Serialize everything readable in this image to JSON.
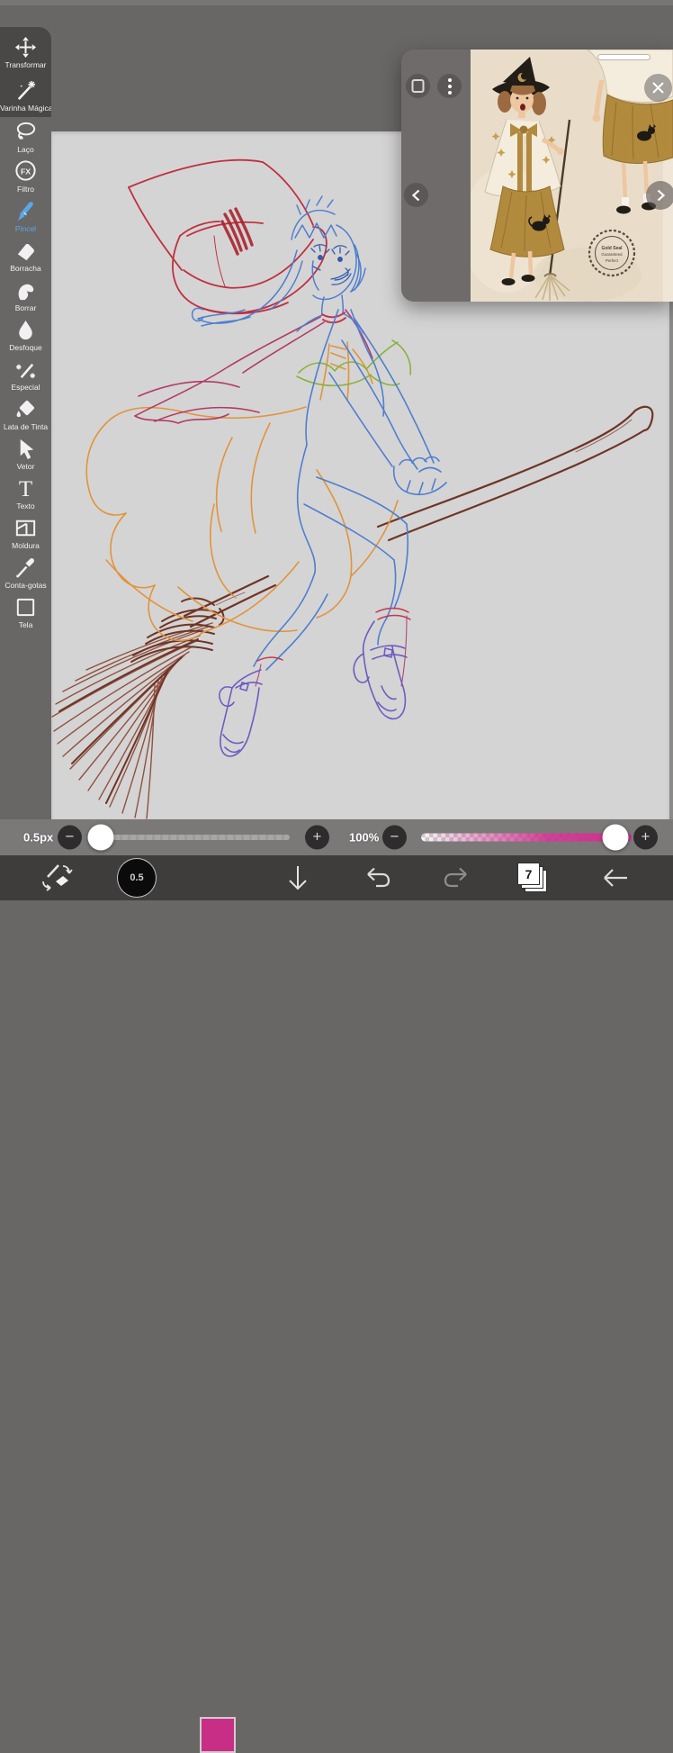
{
  "toolbar": {
    "tools": [
      {
        "label": "Transformar",
        "icon": "move-icon"
      },
      {
        "label": "Varinha Mágica",
        "icon": "magic-wand-icon"
      },
      {
        "label": "Laço",
        "icon": "lasso-icon"
      },
      {
        "label": "Filtro",
        "icon": "fx-icon",
        "glyph": "FX"
      },
      {
        "label": "Pincel",
        "icon": "brush-icon",
        "selected": true
      },
      {
        "label": "Borracha",
        "icon": "eraser-icon"
      },
      {
        "label": "Borrar",
        "icon": "smudge-icon"
      },
      {
        "label": "Desfoque",
        "icon": "blur-drop-icon"
      },
      {
        "label": "Especial",
        "icon": "special-pen-icon"
      },
      {
        "label": "Lata de Tinta",
        "icon": "paint-bucket-icon"
      },
      {
        "label": "Vetor",
        "icon": "vector-cursor-icon"
      },
      {
        "label": "Texto",
        "icon": "text-icon",
        "glyph": "T"
      },
      {
        "label": "Moldura",
        "icon": "frame-icon"
      },
      {
        "label": "Conta-gotas",
        "icon": "eyedropper-icon"
      },
      {
        "label": "Tela",
        "icon": "canvas-icon"
      }
    ]
  },
  "sliders": {
    "brush_size_label": "0.5px",
    "opacity_label": "100%",
    "minus_glyph": "−",
    "plus_glyph": "+"
  },
  "bottom_bar": {
    "brush_size_value": "0.5",
    "layer_count": "7"
  },
  "reference_panel": {
    "seal_lines": [
      "Gold Seal",
      "Guaranteed",
      "Perfect"
    ]
  },
  "colors": {
    "accent_blue": "#58a8e8",
    "current_color": "#c92e86",
    "current_color_style": "background:#c92e86",
    "opacity_slider_color": "#cc2f8d",
    "canvas_bg": "#d5d4d4",
    "backdrop": "#696666"
  }
}
